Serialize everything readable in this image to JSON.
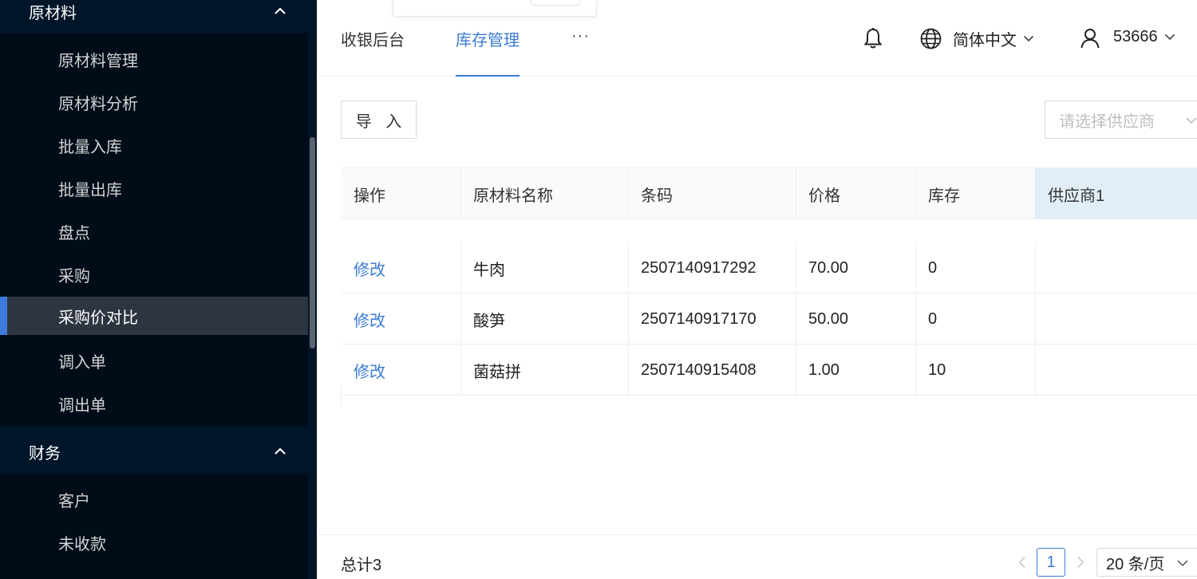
{
  "sidebar": {
    "group_materials": {
      "title": "原材料",
      "icon": "chevron-up-icon"
    },
    "materials_items": [
      {
        "label": "原材料管理"
      },
      {
        "label": "原材料分析"
      },
      {
        "label": "批量入库"
      },
      {
        "label": "批量出库"
      },
      {
        "label": "盘点"
      },
      {
        "label": "采购"
      },
      {
        "label": "采购价对比"
      },
      {
        "label": "调入单"
      },
      {
        "label": "调出单"
      }
    ],
    "active_item": "采购价对比",
    "group_finance": {
      "title": "财务",
      "icon": "chevron-up-icon"
    },
    "finance_items": [
      {
        "label": "客户"
      },
      {
        "label": "未收款"
      }
    ]
  },
  "header": {
    "tabs": [
      {
        "label": "收银后台"
      },
      {
        "label": "库存管理"
      }
    ],
    "active_tab": "库存管理",
    "more_label": "···",
    "language": "简体中文",
    "user": "53666",
    "icons": [
      "bell-icon",
      "globe-icon",
      "user-icon"
    ]
  },
  "toolbar": {
    "import_label": "导 入",
    "supplier_placeholder": "请选择供应商"
  },
  "table": {
    "columns": [
      "操作",
      "原材料名称",
      "条码",
      "价格",
      "库存",
      "供应商1"
    ],
    "highlighted_column": "供应商1",
    "rows": [
      {
        "action": "修改",
        "name": "牛肉",
        "barcode": "2507140917292",
        "price": "70.00",
        "stock": "0",
        "supplier1": ""
      },
      {
        "action": "修改",
        "name": "酸笋",
        "barcode": "2507140917170",
        "price": "50.00",
        "stock": "0",
        "supplier1": ""
      },
      {
        "action": "修改",
        "name": "菌菇拼",
        "barcode": "2507140915408",
        "price": "1.00",
        "stock": "10",
        "supplier1": ""
      }
    ]
  },
  "pagination": {
    "total_label": "总计3",
    "current_page": "1",
    "page_size": "20 条/页"
  },
  "colors": {
    "sidebar_bg": "#001529",
    "submenu_bg": "#000c17",
    "accent": "#3b7bd6",
    "active_item_bg": "#2d3540",
    "highlight_column_bg": "#e1eef8"
  }
}
